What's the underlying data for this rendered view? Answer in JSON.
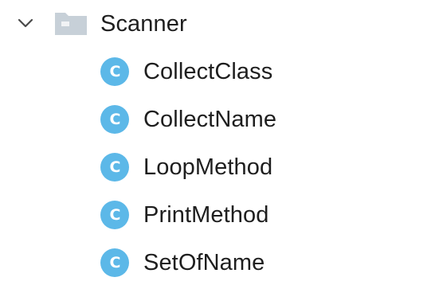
{
  "tree": {
    "folder": {
      "label": "Scanner",
      "expanded": true,
      "icon": "folder-icon",
      "expand_icon": "chevron-down-icon"
    },
    "classes": [
      {
        "label": "CollectClass",
        "icon": "class-icon",
        "icon_letter": "C"
      },
      {
        "label": "CollectName",
        "icon": "class-icon",
        "icon_letter": "C"
      },
      {
        "label": "LoopMethod",
        "icon": "class-icon",
        "icon_letter": "C"
      },
      {
        "label": "PrintMethod",
        "icon": "class-icon",
        "icon_letter": "C"
      },
      {
        "label": "SetOfName",
        "icon": "class-icon",
        "icon_letter": "C"
      }
    ],
    "colors": {
      "class_icon": "#5cb8e8",
      "folder_icon": "#c7d0d8",
      "text": "#1e1e1e"
    }
  }
}
